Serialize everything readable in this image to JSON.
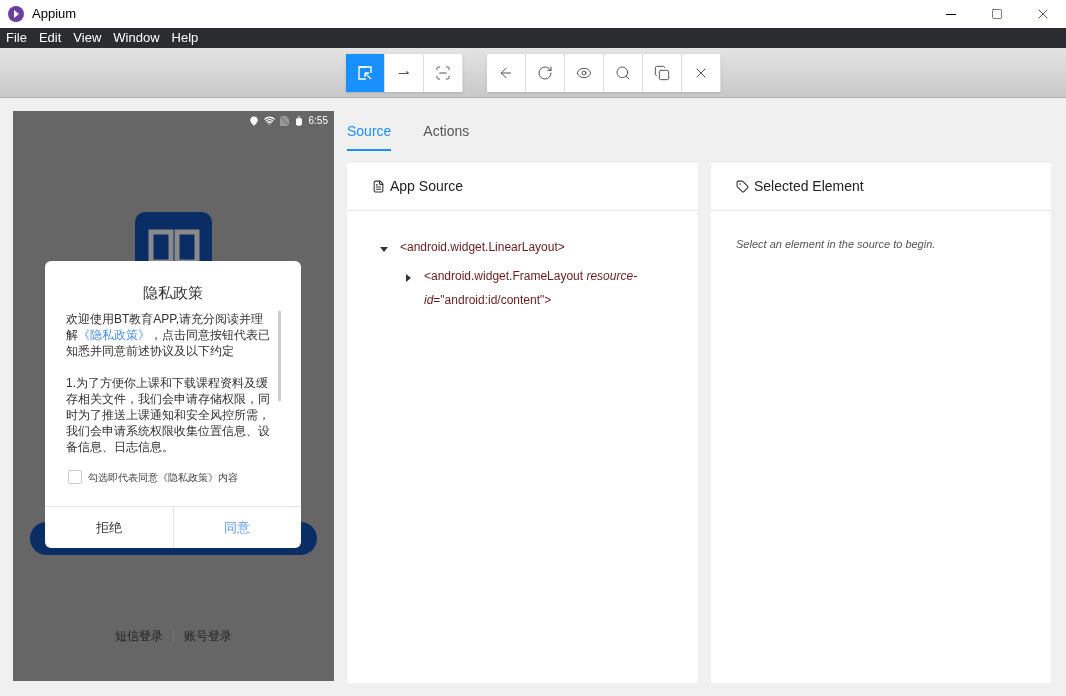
{
  "window": {
    "title": "Appium"
  },
  "menu": [
    "File",
    "Edit",
    "View",
    "Window",
    "Help"
  ],
  "toolbar": {
    "groups": [
      [
        {
          "kind": "select",
          "selected": true
        },
        {
          "kind": "swipe",
          "selected": false
        },
        {
          "kind": "tap",
          "selected": false
        }
      ],
      [
        {
          "kind": "back",
          "selected": false
        },
        {
          "kind": "refresh",
          "selected": false
        },
        {
          "kind": "eye",
          "selected": false
        },
        {
          "kind": "search",
          "selected": false
        },
        {
          "kind": "copy",
          "selected": false
        },
        {
          "kind": "close",
          "selected": false
        }
      ]
    ]
  },
  "device": {
    "status_time": "6:55",
    "dialog": {
      "title": "隐私政策",
      "intro_before": "欢迎使用BT教育APP,请充分阅读并理解",
      "intro_link": "《隐私政策》",
      "intro_after": "，点击同意按钮代表已知悉并同意前述协议及以下约定",
      "paragraph": "1.为了方便你上课和下载课程资料及缓存相关文件，我们会申请存储权限，同时为了推送上课通知和安全风控所需，我们会申请系统权限收集位置信息、设备信息、日志信息。",
      "checkbox": {
        "label": "勾选即代表同意《隐私政策》内容",
        "checked": false
      },
      "buttons": [
        {
          "label": "拒绝",
          "primary": false
        },
        {
          "label": "同意",
          "primary": true
        }
      ]
    },
    "login_links": [
      "短信登录",
      "账号登录"
    ]
  },
  "tabs": [
    {
      "label": "Source",
      "selected": true
    },
    {
      "label": "Actions",
      "selected": false
    }
  ],
  "source_panel": {
    "title": "App Source",
    "tree": [
      {
        "label": "<android.widget.LinearLayout>",
        "expanded": true,
        "children": [
          {
            "label": "<android.widget.FrameLayout *resource-id*=\"android:id/content\">",
            "expanded": false
          }
        ]
      }
    ]
  },
  "selected_panel": {
    "title": "Selected Element",
    "hint": "Select an element in the source to begin."
  }
}
